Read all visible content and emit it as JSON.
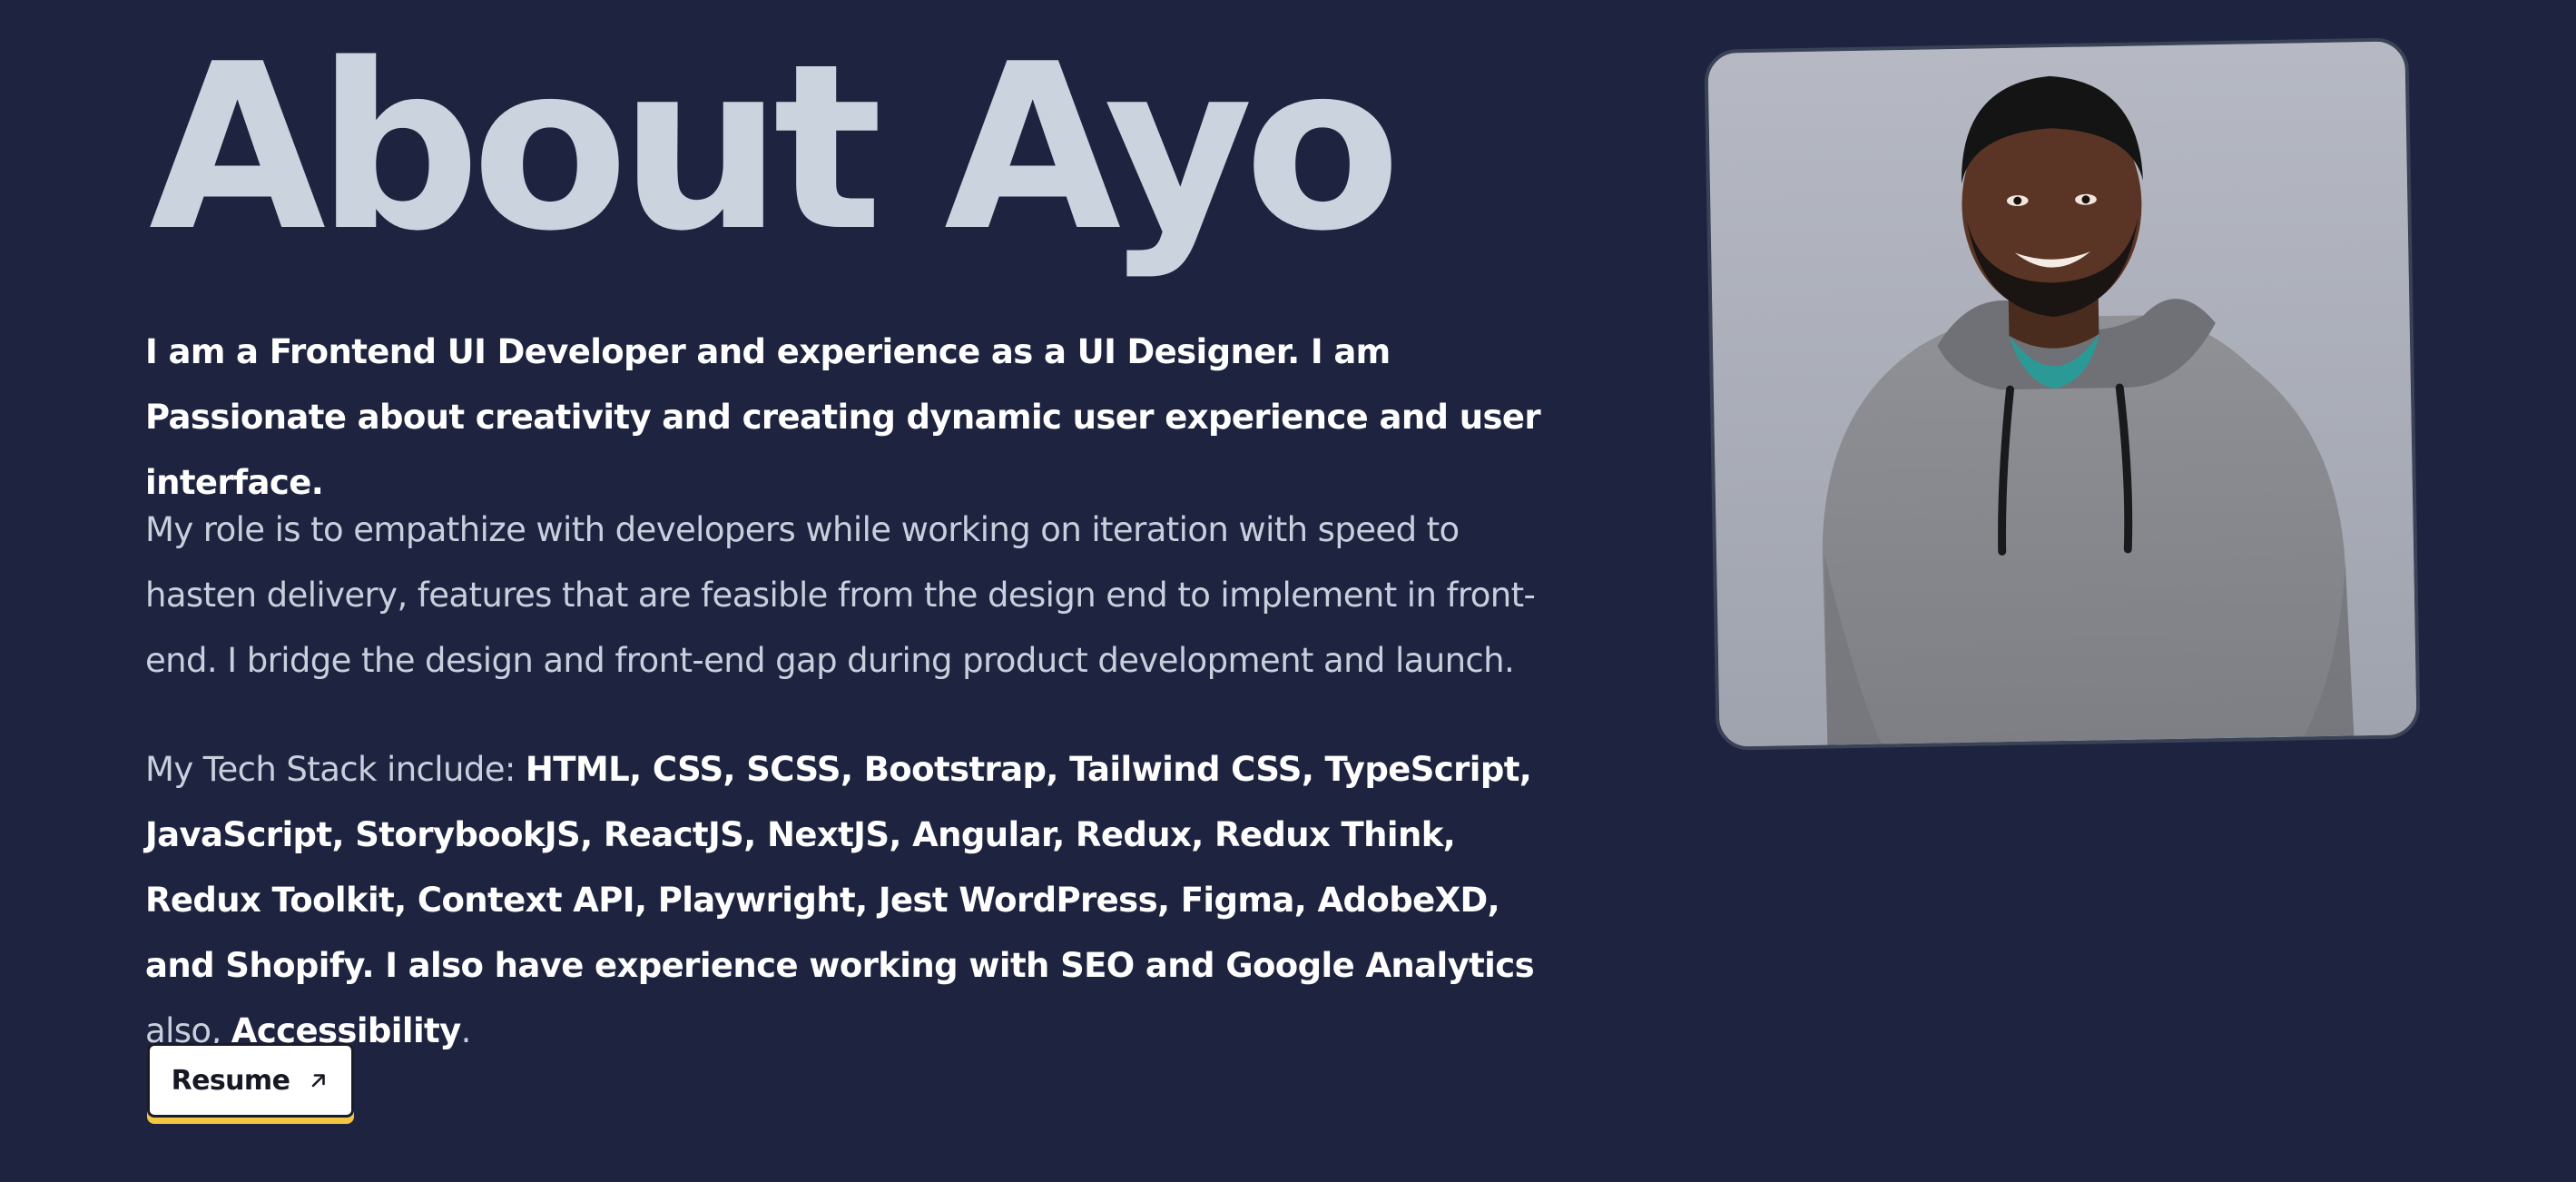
{
  "title": "About Ayo",
  "intro": "I am a Frontend UI Developer and experience as a UI Designer. I am Passionate about creativity and creating dynamic user experience and user interface.",
  "role": "My role is to empathize with developers while working on iteration with speed to hasten delivery, features that are feasible from the design end to implement in front-end. I bridge the design and front-end gap during product development and launch.",
  "stack": {
    "prefix": "My Tech Stack include: ",
    "list": "HTML, CSS, SCSS, Bootstrap, Tailwind CSS, TypeScript, JavaScript, StorybookJS, ReactJS, NextJS, Angular, Redux, Redux Think, Redux Toolkit, Context API, Playwright, Jest WordPress, Figma, AdobeXD, and Shopify. I also have experience working with SEO and Google Analytics",
    "middle": " also, ",
    "accessibility": "Accessibility",
    "end": "."
  },
  "resume": {
    "label": "Resume",
    "icon": "arrow-up-right-icon"
  },
  "photo": {
    "icon": "profile-photo"
  },
  "colors": {
    "background": "#1e2440",
    "title": "#cbd3de",
    "button_accent": "#f4c742"
  }
}
